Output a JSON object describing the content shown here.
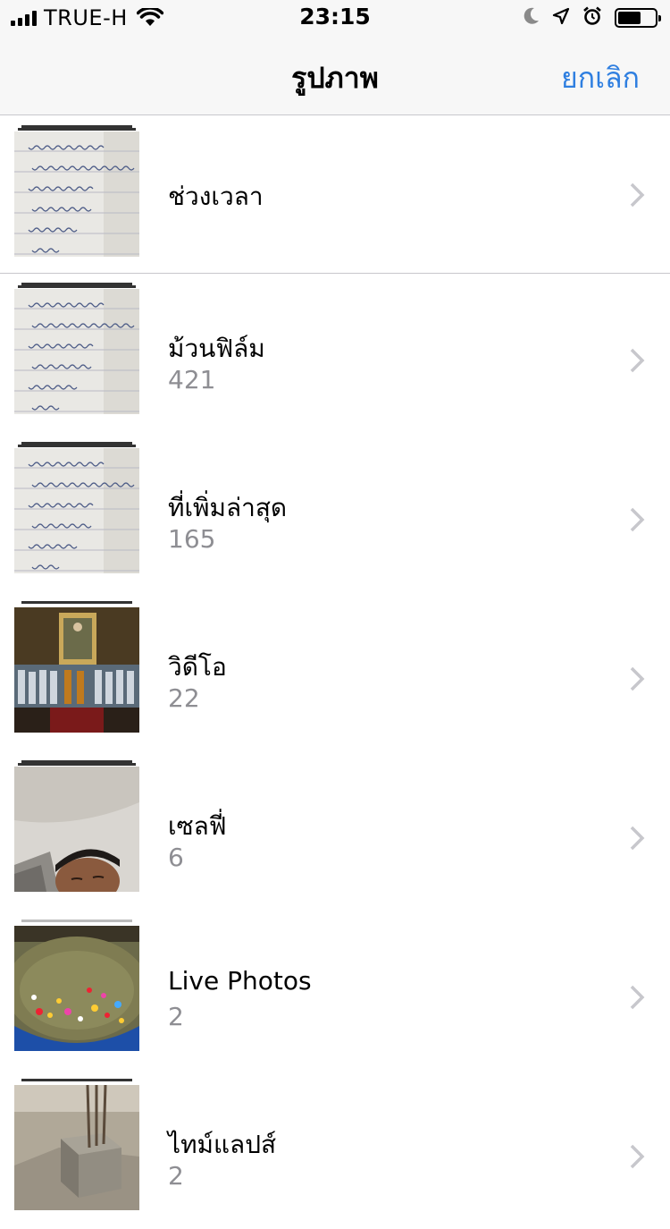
{
  "status": {
    "carrier": "TRUE-H",
    "time": "23:15",
    "battery_level": 0.62
  },
  "nav": {
    "title": "รูปภาพ",
    "cancel_label": "ยกเลิก"
  },
  "albums": [
    {
      "name": "ช่วงเวลา",
      "count": "",
      "thumbnail": "notebook"
    },
    {
      "name": "ม้วนฟิล์ม",
      "count": "421",
      "thumbnail": "notebook"
    },
    {
      "name": "ที่เพิ่มล่าสุด",
      "count": "165",
      "thumbnail": "notebook"
    },
    {
      "name": "วิดีโอ",
      "count": "22",
      "thumbnail": "ceremony"
    },
    {
      "name": "เซลฟี่",
      "count": "6",
      "thumbnail": "car-selfie"
    },
    {
      "name": "Live Photos",
      "count": "2",
      "thumbnail": "water-basin"
    },
    {
      "name": "ไทม์แลปส์",
      "count": "2",
      "thumbnail": "construction"
    }
  ],
  "colors": {
    "accent": "#2f7fe0",
    "secondary_text": "#8e8e93",
    "separator": "#c8c7cc",
    "bar_background": "#f7f7f7"
  }
}
